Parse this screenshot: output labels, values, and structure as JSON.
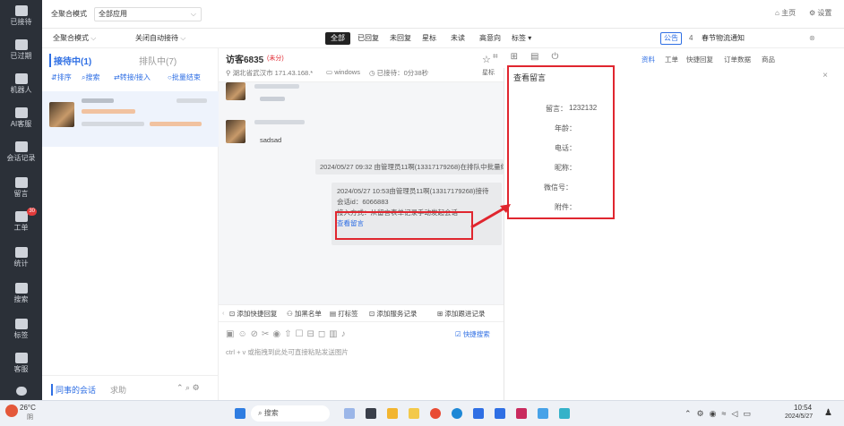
{
  "leftnav": {
    "items": [
      {
        "label": "已接待",
        "icon": "chat-bubble-icon"
      },
      {
        "label": "已过期",
        "icon": "clock-icon"
      },
      {
        "label": "机器人",
        "icon": "robot-icon"
      },
      {
        "label": "AI客服",
        "icon": "ai-service-icon"
      },
      {
        "label": "会话记录",
        "icon": "record-icon"
      },
      {
        "label": "留言",
        "icon": "message-icon"
      },
      {
        "label": "工单",
        "icon": "ticket-icon",
        "badge": "30"
      },
      {
        "label": "统计",
        "icon": "stats-icon"
      },
      {
        "label": "搜索",
        "icon": "search-icon"
      },
      {
        "label": "标签",
        "icon": "tag-icon"
      },
      {
        "label": "客服",
        "icon": "agent-icon"
      }
    ]
  },
  "topbar": {
    "mode_label": "全聚合模式",
    "app_select": "全部应用",
    "home_label": "主页",
    "settings_label": "设置"
  },
  "subbar": {
    "mode_select": "全聚合模式",
    "auto_select": "关闭自动接待",
    "filters": [
      "全部",
      "已回复",
      "未回复",
      "星标",
      "未读",
      "高意向",
      "标签"
    ],
    "active_filter": "全部",
    "notice_badge": "公告",
    "notice_count": "4",
    "notice_text": "春节物流通知"
  },
  "session_list": {
    "tab_active": "接待中(1)",
    "tab_queue": "排队中(7)",
    "actions": [
      "排序",
      "搜索",
      "转接/接入",
      "批量结束"
    ],
    "bottom_tab_active": "同事的会话",
    "bottom_tab_other": "求助"
  },
  "chat": {
    "visitor_name": "访客6835",
    "visitor_tag": "(未分)",
    "location": "湖北省武汉市 171.43.168.*",
    "os": "windows",
    "duration": "已接待：0分38秒",
    "star_label": "星标",
    "msg_text": "sadsad",
    "sys_msg1": "2024/05/27 09:32 由管理员11啊(13317179268)在排队中批量结",
    "card_line1": "2024/05/27 10:53由管理员11啊(13317179268)接待",
    "card_line2": "会话id：6066883",
    "card_line3": "接入方式：从留言表单记录手动发起会话",
    "card_link": "查看留言",
    "toolbar": [
      "添加快捷回复",
      "加黑名单",
      "打标签",
      "添加服务记录",
      "添加跟进记录"
    ],
    "quick_search": "快捷搜索",
    "input_hint": "ctrl + v 或拖拽到此处可直接粘贴发送图片"
  },
  "right_panel": {
    "tabs": [
      "资料",
      "工单",
      "快捷回复",
      "订单数据",
      "商品"
    ],
    "title": "查看留言",
    "fields": [
      {
        "label": "留言：",
        "value": "1232132"
      },
      {
        "label": "年龄：",
        "value": ""
      },
      {
        "label": "电话：",
        "value": ""
      },
      {
        "label": "昵称：",
        "value": ""
      },
      {
        "label": "微信号：",
        "value": ""
      },
      {
        "label": "附件：",
        "value": ""
      }
    ]
  },
  "taskbar": {
    "weather_temp": "26°C",
    "weather_desc": "阴",
    "search_placeholder": "搜索",
    "time": "10:54",
    "date": "2024/5/27"
  },
  "colors": {
    "accent": "#2f6fe4",
    "highlight": "#e0262f",
    "nav": "#2b3038"
  }
}
